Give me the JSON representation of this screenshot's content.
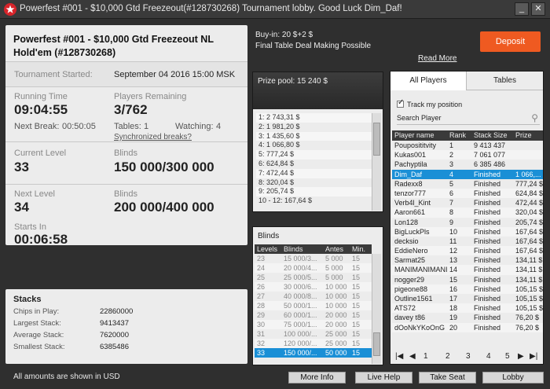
{
  "window": {
    "title": "Powerfest #001 - $10,000 Gtd Freezeout(#128730268) Tournament lobby. Good Luck Dim_Daf!",
    "minimize": "_",
    "close": "✕"
  },
  "tournament": {
    "name": "Powerfest #001 - $10,000 Gtd Freezeout NL Hold'em (#128730268)",
    "started_label": "Tournament Started:",
    "started_value": "September 04 2016   15:00 MSK",
    "running_label": "Running Time",
    "running_value": "09:04:55",
    "players_label": "Players Remaining",
    "players_value": "3/762",
    "next_break_label": "Next Break:",
    "next_break_value": "00:50:05",
    "tables_label": "Tables:",
    "tables_value": "1",
    "watching_label": "Watching:",
    "watching_value": "4",
    "sync_link": "Synchronized breaks?",
    "current_level_label": "Current Level",
    "current_level_value": "33",
    "blinds_label": "Blinds",
    "current_blinds": "150 000/300 000",
    "next_level_label": "Next Level",
    "next_level_value": "34",
    "next_blinds_label": "Blinds",
    "next_blinds": "200 000/400 000",
    "starts_in_label": "Starts In",
    "starts_in_value": "00:06:58"
  },
  "stacks": {
    "title": "Stacks",
    "rows": [
      {
        "label": "Chips in Play:",
        "value": "22860000"
      },
      {
        "label": "Largest Stack:",
        "value": "9413437"
      },
      {
        "label": "Average Stack:",
        "value": "7620000"
      },
      {
        "label": "Smallest Stack:",
        "value": "6385486"
      }
    ]
  },
  "footer_note": "All amounts are shown in USD",
  "info": {
    "buyin": "Buy-in: 20 $+2 $",
    "deal": "Final Table Deal Making Possible",
    "read_more": "Read More",
    "deposit": "Deposit"
  },
  "prize": {
    "title": "Prize pool: 15 240 $",
    "rows": [
      "1: 2 743,31 $",
      "2: 1 981,20 $",
      "3: 1 435,60 $",
      "4: 1 066,80 $",
      "5: 777,24 $",
      "6: 624,84 $",
      "7: 472,44 $",
      "8: 320,04 $",
      "9: 205,74 $",
      "10 - 12: 167,64 $"
    ]
  },
  "blinds": {
    "title": "Blinds",
    "headers": [
      "Levels",
      "Blinds",
      "Antes",
      "Min."
    ],
    "rows": [
      [
        "23",
        "15 000/3...",
        "5 000",
        "15"
      ],
      [
        "24",
        "20 000/4...",
        "5 000",
        "15"
      ],
      [
        "25",
        "25 000/5...",
        "5 000",
        "15"
      ],
      [
        "26",
        "30 000/6...",
        "10 000",
        "15"
      ],
      [
        "27",
        "40 000/8...",
        "10 000",
        "15"
      ],
      [
        "28",
        "50 000/1...",
        "10 000",
        "15"
      ],
      [
        "29",
        "60 000/1...",
        "20 000",
        "15"
      ],
      [
        "30",
        "75 000/1...",
        "20 000",
        "15"
      ],
      [
        "31",
        "100 000/...",
        "25 000",
        "15"
      ],
      [
        "32",
        "120 000/...",
        "25 000",
        "15"
      ],
      [
        "33",
        "150 000/...",
        "50 000",
        "15"
      ]
    ],
    "selected_index": 10
  },
  "players": {
    "tab_all": "All Players",
    "tab_tables": "Tables",
    "track_label": "Track my position",
    "track_checked": "✓",
    "search_label": "Search Player",
    "headers": [
      "Player name",
      "Rank",
      "Stack Size",
      "Prize"
    ],
    "rows": [
      [
        "Pouposititvity",
        "1",
        "9 413 437",
        ""
      ],
      [
        "Kukas001",
        "2",
        "7 061 077",
        ""
      ],
      [
        "Pachyptila",
        "3",
        "6 385 486",
        ""
      ],
      [
        "Dim_Daf",
        "4",
        "Finished",
        "1 066,..."
      ],
      [
        "Radexx8",
        "5",
        "Finished",
        "777,24 $"
      ],
      [
        "tenzor777",
        "6",
        "Finished",
        "624,84 $"
      ],
      [
        "Verb4l_Kint",
        "7",
        "Finished",
        "472,44 $"
      ],
      [
        "Aaron661",
        "8",
        "Finished",
        "320,04 $"
      ],
      [
        "Lon128",
        "9",
        "Finished",
        "205,74 $"
      ],
      [
        "BigLuckPls",
        "10",
        "Finished",
        "167,64 $"
      ],
      [
        "decksio",
        "11",
        "Finished",
        "167,64 $"
      ],
      [
        "EddieNero",
        "12",
        "Finished",
        "167,64 $"
      ],
      [
        "Sarmat25",
        "13",
        "Finished",
        "134,11 $"
      ],
      [
        "MANIMANIMANI",
        "14",
        "Finished",
        "134,11 $"
      ],
      [
        "nogger29",
        "15",
        "Finished",
        "134,11 $"
      ],
      [
        "pigeone88",
        "16",
        "Finished",
        "105,15 $"
      ],
      [
        "Outline1561",
        "17",
        "Finished",
        "105,15 $"
      ],
      [
        "ATS72",
        "18",
        "Finished",
        "105,15 $"
      ],
      [
        "davey t86",
        "19",
        "Finished",
        "76,20 $"
      ],
      [
        "dOoNkYKoOnG",
        "20",
        "Finished",
        "76,20 $"
      ]
    ],
    "selected_index": 3,
    "pages": [
      "1",
      "2",
      "3",
      "4",
      "5"
    ],
    "first": "|◀",
    "prev": "◀",
    "next": "▶",
    "last": "▶|"
  },
  "buttons": {
    "more_info": "More Info",
    "live_help": "Live Help",
    "take_seat": "Take Seat",
    "lobby": "Lobby"
  }
}
